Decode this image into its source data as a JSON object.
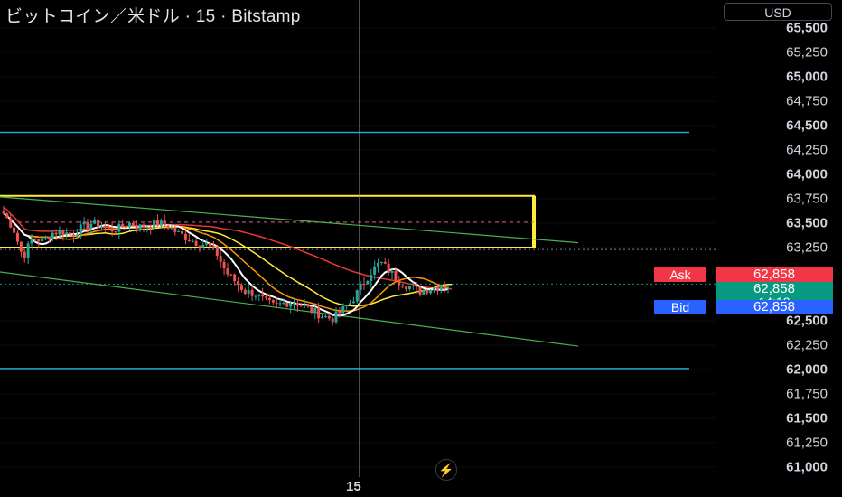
{
  "header": {
    "title": "ビットコイン／米ドル · 15 · Bitstamp",
    "currency": "USD"
  },
  "price_axis": {
    "ticks": [
      {
        "label": "65,500",
        "value": 65500,
        "major": true
      },
      {
        "label": "65,250",
        "value": 65250,
        "major": false
      },
      {
        "label": "65,000",
        "value": 65000,
        "major": true
      },
      {
        "label": "64,750",
        "value": 64750,
        "major": false
      },
      {
        "label": "64,500",
        "value": 64500,
        "major": true
      },
      {
        "label": "64,250",
        "value": 64250,
        "major": false
      },
      {
        "label": "64,000",
        "value": 64000,
        "major": true
      },
      {
        "label": "63,750",
        "value": 63750,
        "major": false
      },
      {
        "label": "63,500",
        "value": 63500,
        "major": true
      },
      {
        "label": "63,250",
        "value": 63250,
        "major": false
      },
      {
        "label": "62,500",
        "value": 62500,
        "major": true
      },
      {
        "label": "62,250",
        "value": 62250,
        "major": false
      },
      {
        "label": "62,000",
        "value": 62000,
        "major": true
      },
      {
        "label": "61,750",
        "value": 61750,
        "major": false
      },
      {
        "label": "61,500",
        "value": 61500,
        "major": true
      },
      {
        "label": "61,250",
        "value": 61250,
        "major": false
      },
      {
        "label": "61,000",
        "value": 61000,
        "major": true
      }
    ]
  },
  "quote": {
    "ask_label": "Ask",
    "ask_price": "62,858",
    "last_price": "62,858",
    "countdown": "14:18",
    "bid_label": "Bid",
    "bid_price": "62,858"
  },
  "time_axis": {
    "crosshair_label": "15"
  },
  "colors": {
    "background": "#000000",
    "ask": "#f23645",
    "last": "#089981",
    "bid": "#2962ff",
    "up": "#26a69a",
    "down": "#ef5350",
    "horizontal_lines": "#21a8c8",
    "channel": "#4caf50",
    "zone": "#ffeb3b",
    "ma_red": "#e53935",
    "ma_orange": "#ff9800",
    "ma_yellow": "#ffeb3b",
    "ma_white": "#ffffff"
  },
  "icons": {
    "bottom_button": "lightning-icon"
  },
  "chart_data": {
    "type": "candlestick",
    "symbol": "ビットコイン／米ドル",
    "interval": "15",
    "exchange": "Bitstamp",
    "currency": "USD",
    "y_range": [
      61000,
      65500
    ],
    "last_price": 62858,
    "horizontal_levels": [
      64430,
      62010
    ],
    "resistance_zone": {
      "top": 63780,
      "bottom": 63250
    },
    "channel_upper": {
      "start": 63770,
      "end": 63300
    },
    "channel_lower": {
      "start": 63000,
      "end": 62240
    },
    "close_path": [
      63600,
      63450,
      63150,
      63350,
      63320,
      63400,
      63420,
      63380,
      63450,
      63500,
      63480,
      63430,
      63450,
      63500,
      63460,
      63480,
      63500,
      63470,
      63400,
      63350,
      63300,
      63280,
      63200,
      63000,
      62900,
      62800,
      62780,
      62700,
      62650,
      62680,
      62700,
      62650,
      62600,
      62550,
      62520,
      62600,
      62700,
      62850,
      63000,
      63100,
      63000,
      62900,
      62850,
      62800,
      62830,
      62860,
      62858
    ]
  }
}
